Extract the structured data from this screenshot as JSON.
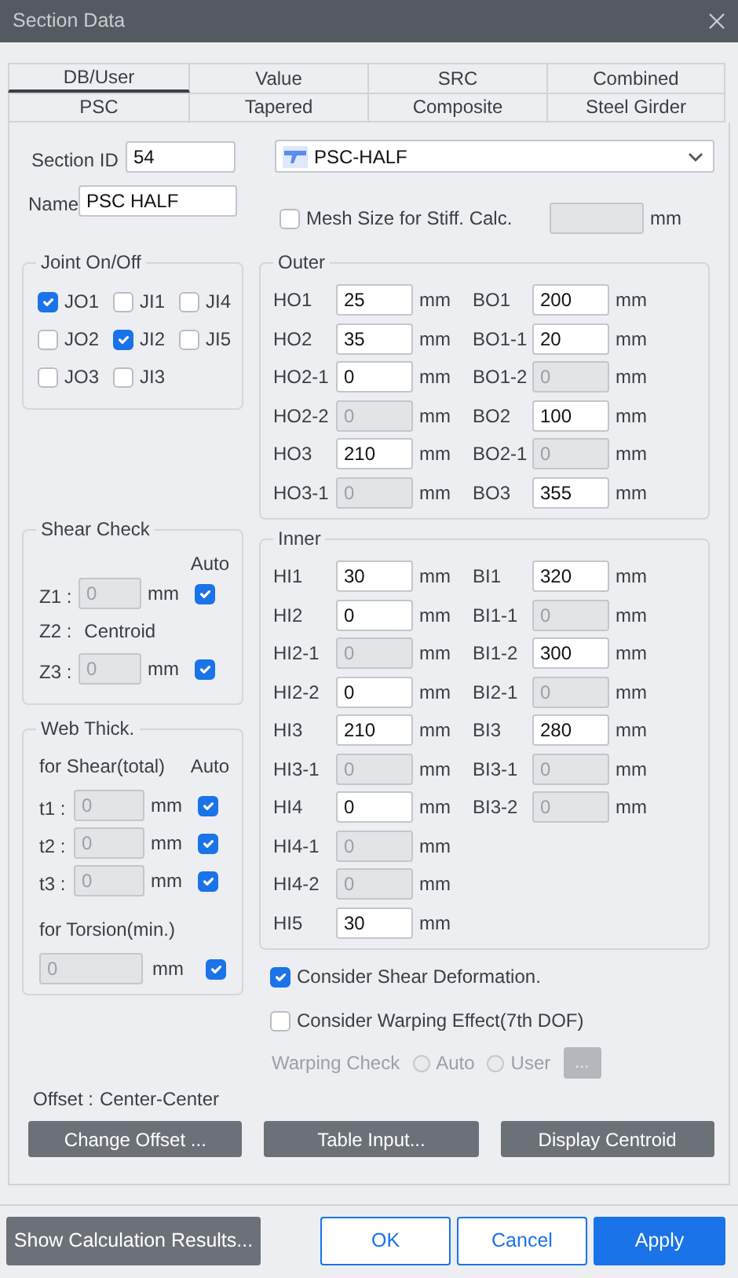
{
  "window": {
    "title": "Section Data"
  },
  "tab_rows": [
    {
      "tabs": [
        {
          "label": "DB/User",
          "selected": true
        },
        {
          "label": "Value",
          "selected": false
        },
        {
          "label": "SRC",
          "selected": false
        },
        {
          "label": "Combined",
          "selected": false
        }
      ]
    },
    {
      "tabs": [
        {
          "label": "PSC",
          "selected": false
        },
        {
          "label": "Tapered",
          "selected": false
        },
        {
          "label": "Composite",
          "selected": false
        },
        {
          "label": "Steel Girder",
          "selected": false
        }
      ]
    }
  ],
  "section_id": {
    "label": "Section ID",
    "value": "54"
  },
  "name": {
    "label": "Name",
    "value": "PSC HALF"
  },
  "section_type": {
    "value": "PSC-HALF"
  },
  "mesh_size": {
    "label": "Mesh Size for Stiff. Calc.",
    "checked": false,
    "disabled": true,
    "unit": "mm"
  },
  "joint_on_off": {
    "title": "Joint On/Off",
    "items": [
      {
        "label": "JO1",
        "checked": true
      },
      {
        "label": "JI1",
        "checked": false
      },
      {
        "label": "JI4",
        "checked": false
      },
      {
        "label": "JO2",
        "checked": false
      },
      {
        "label": "JI2",
        "checked": true
      },
      {
        "label": "JI5",
        "checked": false
      },
      {
        "label": "JO3",
        "checked": false
      },
      {
        "label": "JI3",
        "checked": false
      }
    ]
  },
  "outer": {
    "title": "Outer",
    "columns": [
      [
        {
          "label": "HO1",
          "value": "25",
          "unit": "mm",
          "disabled": false
        },
        {
          "label": "HO2",
          "value": "35",
          "unit": "mm",
          "disabled": false
        },
        {
          "label": "HO2-1",
          "value": "0",
          "unit": "mm",
          "disabled": false
        },
        {
          "label": "HO2-2",
          "value": "0",
          "unit": "mm",
          "disabled": true
        },
        {
          "label": "HO3",
          "value": "210",
          "unit": "mm",
          "disabled": false
        },
        {
          "label": "HO3-1",
          "value": "0",
          "unit": "mm",
          "disabled": true
        }
      ],
      [
        {
          "label": "BO1",
          "value": "200",
          "unit": "mm",
          "disabled": false
        },
        {
          "label": "BO1-1",
          "value": "20",
          "unit": "mm",
          "disabled": false
        },
        {
          "label": "BO1-2",
          "value": "0",
          "unit": "mm",
          "disabled": true
        },
        {
          "label": "BO2",
          "value": "100",
          "unit": "mm",
          "disabled": false
        },
        {
          "label": "BO2-1",
          "value": "0",
          "unit": "mm",
          "disabled": true
        },
        {
          "label": "BO3",
          "value": "355",
          "unit": "mm",
          "disabled": false
        }
      ]
    ]
  },
  "inner": {
    "title": "Inner",
    "columns": [
      [
        {
          "label": "HI1",
          "value": "30",
          "unit": "mm",
          "disabled": false
        },
        {
          "label": "HI2",
          "value": "0",
          "unit": "mm",
          "disabled": false
        },
        {
          "label": "HI2-1",
          "value": "0",
          "unit": "mm",
          "disabled": true
        },
        {
          "label": "HI2-2",
          "value": "0",
          "unit": "mm",
          "disabled": false
        },
        {
          "label": "HI3",
          "value": "210",
          "unit": "mm",
          "disabled": false
        },
        {
          "label": "HI3-1",
          "value": "0",
          "unit": "mm",
          "disabled": true
        },
        {
          "label": "HI4",
          "value": "0",
          "unit": "mm",
          "disabled": false
        },
        {
          "label": "HI4-1",
          "value": "0",
          "unit": "mm",
          "disabled": true
        },
        {
          "label": "HI4-2",
          "value": "0",
          "unit": "mm",
          "disabled": true
        },
        {
          "label": "HI5",
          "value": "30",
          "unit": "mm",
          "disabled": false
        }
      ],
      [
        {
          "label": "BI1",
          "value": "320",
          "unit": "mm",
          "disabled": false
        },
        {
          "label": "BI1-1",
          "value": "0",
          "unit": "mm",
          "disabled": true
        },
        {
          "label": "BI1-2",
          "value": "300",
          "unit": "mm",
          "disabled": false
        },
        {
          "label": "BI2-1",
          "value": "0",
          "unit": "mm",
          "disabled": true
        },
        {
          "label": "BI3",
          "value": "280",
          "unit": "mm",
          "disabled": false
        },
        {
          "label": "BI3-1",
          "value": "0",
          "unit": "mm",
          "disabled": true
        },
        {
          "label": "BI3-2",
          "value": "0",
          "unit": "mm",
          "disabled": true
        }
      ]
    ]
  },
  "shear_check": {
    "title": "Shear Check",
    "auto_label": "Auto",
    "rows": [
      {
        "kind": "field",
        "label": "Z1 :",
        "value": "0",
        "unit": "mm",
        "disabled": true,
        "auto": true
      },
      {
        "kind": "text",
        "label": "Z2 :",
        "value": "Centroid"
      },
      {
        "kind": "field",
        "label": "Z3 :",
        "value": "0",
        "unit": "mm",
        "disabled": true,
        "auto": true
      }
    ]
  },
  "web_thick": {
    "title": "Web Thick.",
    "shear_label": "for Shear(total)",
    "auto_label": "Auto",
    "rows": [
      {
        "kind": "field",
        "label": "t1 :",
        "value": "0",
        "unit": "mm",
        "disabled": true,
        "auto": true
      },
      {
        "kind": "field",
        "label": "t2 :",
        "value": "0",
        "unit": "mm",
        "disabled": true,
        "auto": true
      },
      {
        "kind": "field",
        "label": "t3 :",
        "value": "0",
        "unit": "mm",
        "disabled": true,
        "auto": true
      }
    ],
    "torsion_label": "for Torsion(min.)",
    "torsion": {
      "value": "0",
      "unit": "mm",
      "disabled": true,
      "auto": true
    }
  },
  "options": [
    {
      "label": "Consider Shear Deformation.",
      "checked": true
    },
    {
      "label": "Consider Warping Effect(7th DOF)",
      "checked": false
    }
  ],
  "warping_check": {
    "label": "Warping Check",
    "disabled": true,
    "options": [
      {
        "label": "Auto",
        "selected": false
      },
      {
        "label": "User",
        "selected": false
      }
    ],
    "button": "..."
  },
  "offset": {
    "label": "Offset :",
    "value": "Center-Center"
  },
  "panel_buttons": [
    "Change Offset ...",
    "Table Input...",
    "Display Centroid"
  ],
  "footer_buttons": [
    {
      "label": "Show Calculation Results...",
      "kind": "secondary"
    },
    {
      "label": "OK",
      "kind": "outline"
    },
    {
      "label": "Cancel",
      "kind": "outline"
    },
    {
      "label": "Apply",
      "kind": "primary"
    }
  ]
}
